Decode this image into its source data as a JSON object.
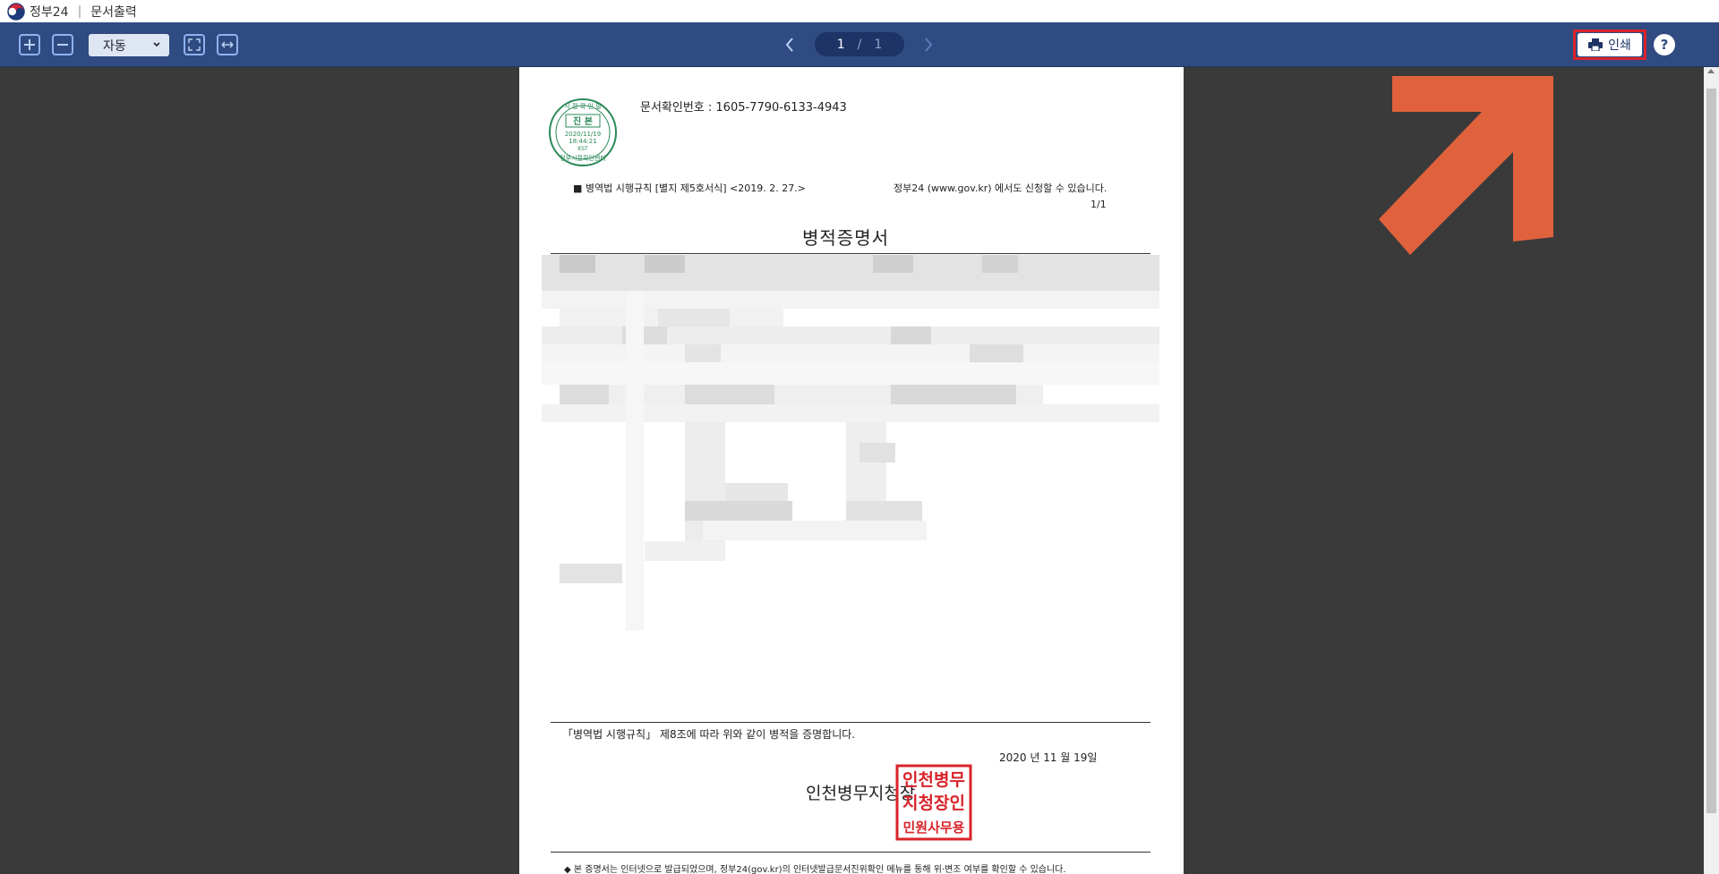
{
  "app": {
    "site_name": "정부24",
    "separator": "|",
    "window_title": "문서출력"
  },
  "toolbar": {
    "zoom_in_icon": "plus-icon",
    "zoom_out_icon": "minus-icon",
    "zoom_select_value": "자동",
    "fit_page_icon": "fit-page-icon",
    "fit_width_icon": "fit-width-icon",
    "current_page": "1",
    "page_separator": "/",
    "total_pages": "1",
    "print_label": "인쇄",
    "help_label": "?",
    "accent_color": "#2f4b82",
    "highlight_color": "#d9232a"
  },
  "document": {
    "seal": {
      "top_text": "시 절 확 인 필",
      "center_text": "진 본",
      "date": "2020/11/19",
      "time": "18:44:21",
      "tz": "KST",
      "bottom_text": "정부시절확인센터"
    },
    "doc_number": "문서확인번호 : 1605-7790-6133-4943",
    "form_reference": "■ 병역법 시행규칙 [별지 제5호서식] <2019. 2. 27.>",
    "apply_note": "정부24 (www.gov.kr) 에서도 신청할 수 있습니다.",
    "page_count": "1/1",
    "title": "병적증명서",
    "declaration": "「병역법 시행규칙」 제8조에 따라 위와 같이 병적을 증명합니다.",
    "issue_date": "2020 년 11 월 19일",
    "issuer": "인천병무지청장",
    "stamp_lines": [
      "인천병무",
      "지청장인",
      "민원사무용"
    ],
    "footnote": "◆ 본 증명서는 인터넷으로 발급되었으며, 정부24(gov.kr)의 인터넷발급문서진위확인 메뉴를 통해 위·변조 여부를 확인할 수 있습니다."
  },
  "annotation": {
    "arrow_color": "#e0623c",
    "arrow_icon": "pointer-arrow-icon"
  }
}
